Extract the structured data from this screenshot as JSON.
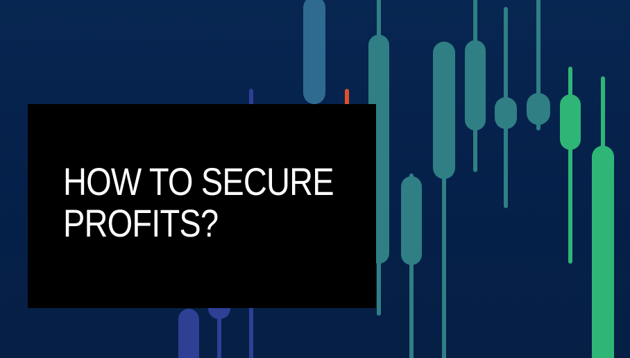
{
  "headline": {
    "line1": "HOW TO SECURE",
    "line2": "PROFITS?"
  },
  "palette": {
    "background": "#06234d",
    "box": "#000000",
    "text": "#ffffff",
    "candle_blue": "#2e3f94",
    "candle_steel": "#2f6b91",
    "candle_teal": "#2f7f85",
    "candle_green": "#2fb576",
    "candle_red": "#e0502a"
  },
  "decoration": {
    "icon": "candlestick-chart-icon"
  }
}
